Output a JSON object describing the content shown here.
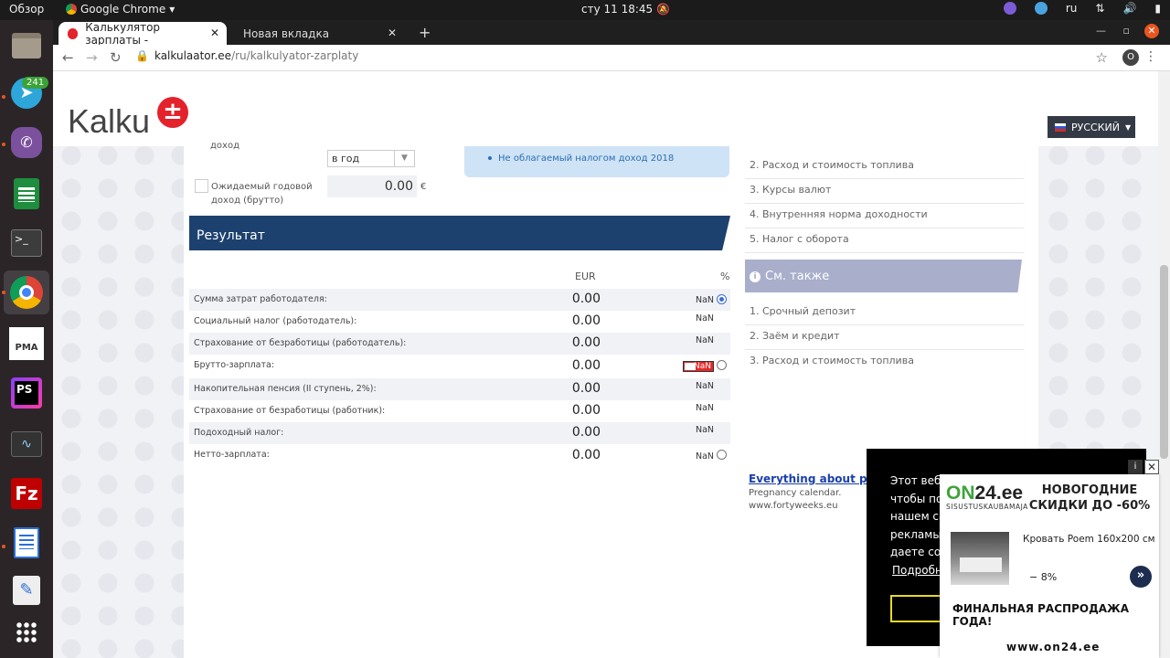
{
  "system": {
    "overview": "Обзор",
    "app_name": "Google Chrome",
    "clock": "сту 11  18:45",
    "lang": "ru"
  },
  "dock": {
    "telegram_badge": "241",
    "items": [
      "files-icon",
      "telegram-icon",
      "viber-icon",
      "spreadsheet-icon",
      "terminal-icon",
      "chrome-icon",
      "phpmyadmin-icon",
      "phpstorm-icon",
      "system-monitor-icon",
      "filezilla-icon",
      "document-icon",
      "text-editor-icon",
      "apps-grid-icon"
    ]
  },
  "browser": {
    "tab_active": "Калькулятор зарплаты -",
    "tab_inactive": "Новая вкладка",
    "url_host": "kalkulaator.ee",
    "url_path": "/ru/kalkulyator-zarplaty",
    "profile_letter": "O"
  },
  "header": {
    "logo": "Kalku",
    "logo_badge": "±",
    "language": "РУССКИЙ"
  },
  "form": {
    "income_label": "доход",
    "period_value": "в год",
    "expected_label": "Ожидаемый годовой доход (брутто)",
    "expected_value": "0.00",
    "currency": "€",
    "info_item": "Не облагаемый налогом доход 2018"
  },
  "result": {
    "title": "Результат",
    "col_eur": "EUR",
    "col_pct": "%",
    "rows": [
      {
        "label": "Сумма затрат работодателя:",
        "value": "0.00",
        "pct": "NaN"
      },
      {
        "label": "Социальный налог (работодатель):",
        "value": "0.00",
        "pct": "NaN"
      },
      {
        "label": "Страхование от безработицы (работодатель):",
        "value": "0.00",
        "pct": "NaN"
      },
      {
        "label": "Брутто-зарплата:",
        "value": "0.00",
        "pct": "NaN"
      },
      {
        "label": "Накопительная пенсия (II ступень, 2%):",
        "value": "0.00",
        "pct": "NaN"
      },
      {
        "label": "Страхование от безработицы (работник):",
        "value": "0.00",
        "pct": "NaN"
      },
      {
        "label": "Подоходный налог:",
        "value": "0.00",
        "pct": "NaN"
      },
      {
        "label": "Нетто-зарплата:",
        "value": "0.00",
        "pct": "NaN"
      }
    ]
  },
  "sidebar": {
    "links": [
      "2. Расход и стоимость топлива",
      "3. Курсы валют",
      "4. Внутренняя норма доходности",
      "5. Налог с оборота"
    ],
    "see_also_title": "См. также",
    "see_also": [
      "1. Срочный депозит",
      "2. Заём и кредит",
      "3. Расход и стоимость топлива"
    ],
    "ad_link": "Everything about pregna",
    "ad_line1": "Pregnancy calendar.",
    "ad_line2": "www.fortyweeks.eu"
  },
  "cookie": {
    "lines": [
      "Этот веб-",
      "чтобы по",
      "нашем са",
      "рекламы.",
      "даете сог"
    ],
    "more": "Подробн"
  },
  "ad": {
    "brand_on": "ON",
    "brand_rest": "24.ee",
    "brand_sub": "SISUSTUSKAUBAMAJA",
    "promo": "НОВОГОДНИЕ СКИДКИ ДО -60%",
    "product": "Кровать Poem 160x200 см",
    "discount": "− 8%",
    "go": "»",
    "final": "ФИНАЛЬНАЯ РАСПРОДАЖА ГОДА!",
    "site": "www.on24.ee",
    "info": "i",
    "close": "✕"
  },
  "colors": {
    "result_banner": "#1c416e",
    "see_also_banner": "#a9aecb",
    "logo_red": "#e4222b",
    "ubuntu_orange": "#e95420"
  }
}
